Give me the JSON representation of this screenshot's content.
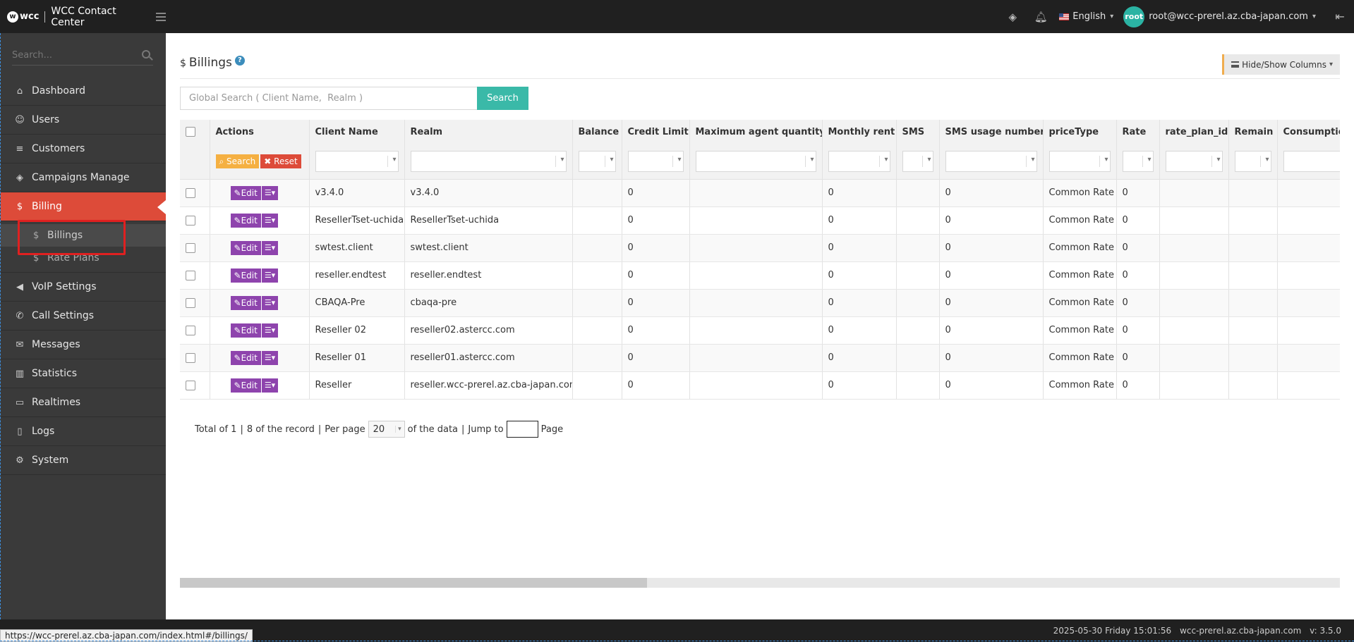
{
  "topbar": {
    "logo_text": "wcc",
    "app_title": "WCC Contact Center",
    "language": "English",
    "avatar_label": "root",
    "user_email": "root@wcc-prerel.az.cba-japan.com"
  },
  "sidebar": {
    "search_placeholder": "Search...",
    "items": [
      {
        "label": "Dashboard",
        "icon": "home-icon",
        "glyph": "⌂"
      },
      {
        "label": "Users",
        "icon": "user-icon",
        "glyph": "☺"
      },
      {
        "label": "Customers",
        "icon": "database-icon",
        "glyph": "≡"
      },
      {
        "label": "Campaigns Manage",
        "icon": "layers-icon",
        "glyph": "◈"
      },
      {
        "label": "Billing",
        "icon": "dollar-icon",
        "glyph": "$"
      },
      {
        "label": "VoIP Settings",
        "icon": "volume-icon",
        "glyph": "◀"
      },
      {
        "label": "Call Settings",
        "icon": "phone-icon",
        "glyph": "✆"
      },
      {
        "label": "Messages",
        "icon": "envelope-icon",
        "glyph": "✉"
      },
      {
        "label": "Statistics",
        "icon": "bar-chart-icon",
        "glyph": "▥"
      },
      {
        "label": "Realtimes",
        "icon": "monitor-icon",
        "glyph": "▭"
      },
      {
        "label": "Logs",
        "icon": "book-icon",
        "glyph": "▯"
      },
      {
        "label": "System",
        "icon": "gear-icon",
        "glyph": "⚙"
      }
    ],
    "billing_sub": [
      {
        "label": "Billings",
        "glyph": "$"
      },
      {
        "label": "Rate Plans",
        "glyph": "$"
      }
    ]
  },
  "page": {
    "title": "Billings",
    "title_glyph": "$",
    "help": "?",
    "hide_show_label": "Hide/Show Columns",
    "search_placeholder": "Global Search ( Client Name,  Realm )",
    "search_button": "Search",
    "filter_search": "Search",
    "filter_reset": "Reset"
  },
  "table": {
    "columns": [
      "Actions",
      "Client Name",
      "Realm",
      "Balance",
      "Credit Limit",
      "Maximum agent quantity",
      "Monthly rent",
      "SMS",
      "SMS usage number",
      "priceType",
      "Rate",
      "rate_plan_id",
      "Remain",
      "Consumption"
    ],
    "edit_label": "Edit",
    "rows": [
      {
        "client": "v3.4.0",
        "realm": "v3.4.0",
        "balance": "",
        "credit": "0",
        "maxagent": "",
        "rent": "0",
        "sms": "",
        "smsusage": "0",
        "pricetype": "Common Rate",
        "rate": "0",
        "planid": "",
        "remain": "",
        "consumption": ""
      },
      {
        "client": "ResellerTset-uchida",
        "realm": "ResellerTset-uchida",
        "balance": "",
        "credit": "0",
        "maxagent": "",
        "rent": "0",
        "sms": "",
        "smsusage": "0",
        "pricetype": "Common Rate",
        "rate": "0",
        "planid": "",
        "remain": "",
        "consumption": ""
      },
      {
        "client": "swtest.client",
        "realm": "swtest.client",
        "balance": "",
        "credit": "0",
        "maxagent": "",
        "rent": "0",
        "sms": "",
        "smsusage": "0",
        "pricetype": "Common Rate",
        "rate": "0",
        "planid": "",
        "remain": "",
        "consumption": ""
      },
      {
        "client": "reseller.endtest",
        "realm": "reseller.endtest",
        "balance": "",
        "credit": "0",
        "maxagent": "",
        "rent": "0",
        "sms": "",
        "smsusage": "0",
        "pricetype": "Common Rate",
        "rate": "0",
        "planid": "",
        "remain": "",
        "consumption": ""
      },
      {
        "client": "CBAQA-Pre",
        "realm": "cbaqa-pre",
        "balance": "",
        "credit": "0",
        "maxagent": "",
        "rent": "0",
        "sms": "",
        "smsusage": "0",
        "pricetype": "Common Rate",
        "rate": "0",
        "planid": "",
        "remain": "",
        "consumption": ""
      },
      {
        "client": "Reseller 02",
        "realm": "reseller02.astercc.com",
        "balance": "",
        "credit": "0",
        "maxagent": "",
        "rent": "0",
        "sms": "",
        "smsusage": "0",
        "pricetype": "Common Rate",
        "rate": "0",
        "planid": "",
        "remain": "",
        "consumption": ""
      },
      {
        "client": "Reseller 01",
        "realm": "reseller01.astercc.com",
        "balance": "",
        "credit": "0",
        "maxagent": "",
        "rent": "0",
        "sms": "",
        "smsusage": "0",
        "pricetype": "Common Rate",
        "rate": "0",
        "planid": "",
        "remain": "",
        "consumption": ""
      },
      {
        "client": "Reseller",
        "realm": "reseller.wcc-prerel.az.cba-japan.com",
        "balance": "",
        "credit": "0",
        "maxagent": "",
        "rent": "0",
        "sms": "",
        "smsusage": "0",
        "pricetype": "Common Rate",
        "rate": "0",
        "planid": "",
        "remain": "",
        "consumption": ""
      }
    ]
  },
  "pager": {
    "total_text": "Total of 1",
    "records_text": "8 of the record",
    "per_page_label": "Per page",
    "per_page_value": "20",
    "of_data": "of the data",
    "jump_label": "Jump to",
    "page_label": "Page"
  },
  "footer": {
    "datetime": "2025-05-30 Friday 15:01:56",
    "host": "wcc-prerel.az.cba-japan.com",
    "version": "v: 3.5.0",
    "status_url": "https://wcc-prerel.az.cba-japan.com/index.html#/billings/"
  },
  "colors": {
    "accent": "#dd4b39",
    "search_button": "#3ab9a8",
    "edit_button": "#8e44ad",
    "sidebar_bg": "#3a3a3a",
    "topbar_bg": "#202020"
  }
}
